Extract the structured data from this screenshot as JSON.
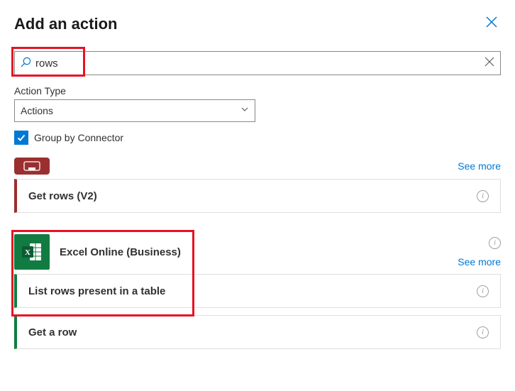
{
  "header": {
    "title": "Add an action"
  },
  "search": {
    "value": "rows"
  },
  "actionType": {
    "label": "Action Type",
    "selected": "Actions"
  },
  "groupBy": {
    "label": "Group by Connector",
    "checked": true
  },
  "seeMore": "See more",
  "groups": [
    {
      "connector": "",
      "accent": "sql",
      "actions": [
        {
          "title": "Get rows (V2)"
        }
      ]
    },
    {
      "connector": "Excel Online (Business)",
      "accent": "excel",
      "actions": [
        {
          "title": "List rows present in a table"
        },
        {
          "title": "Get a row"
        }
      ]
    }
  ]
}
